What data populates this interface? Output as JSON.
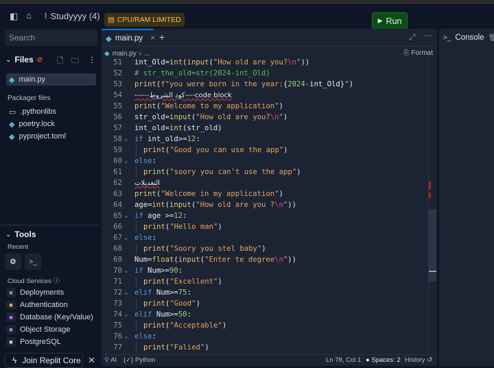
{
  "topbar": {
    "project": "Studyyyy (4)",
    "badge": "CPU/RAM LIMITED",
    "run": "Run"
  },
  "sidebar": {
    "search_placeholder": "Search",
    "files_title": "Files",
    "files": [
      {
        "name": "main.py",
        "icon": "python-icon"
      }
    ],
    "packager_title": "Packager files",
    "packager": [
      {
        "name": ".pythonlibs",
        "icon": "folder-icon"
      },
      {
        "name": "poetry.lock",
        "icon": "python-icon"
      },
      {
        "name": "pyproject.toml",
        "icon": "python-icon"
      }
    ],
    "tools_title": "Tools",
    "recent_title": "Recent",
    "cloud_title": "Cloud Services",
    "services": [
      {
        "name": "Deployments",
        "icon": "deployments-icon",
        "color": "#5dbb63"
      },
      {
        "name": "Authentication",
        "icon": "user-icon",
        "color": "#e8a55c"
      },
      {
        "name": "Database (Key/Value)",
        "icon": "database-icon",
        "color": "#a07ef0"
      },
      {
        "name": "Object Storage",
        "icon": "storage-icon",
        "color": "#4fb8d0"
      },
      {
        "name": "PostgreSQL",
        "icon": "postgres-icon",
        "color": "#c8ccd4"
      }
    ],
    "join": "Join Replit Core"
  },
  "editor": {
    "tab": "main.py",
    "breadcrumb": "main.py",
    "breadcrumb_more": "...",
    "format": "Format",
    "lines": [
      {
        "n": "51",
        "t": [
          [
            "p",
            "int_Old="
          ],
          [
            "f",
            "int"
          ],
          [
            "p",
            "("
          ],
          [
            "f",
            "input"
          ],
          [
            "p",
            "("
          ],
          [
            "s",
            "\"How old are you?"
          ],
          [
            "e",
            "\\n"
          ],
          [
            "s",
            "\""
          ],
          [
            "p",
            "))"
          ]
        ]
      },
      {
        "n": "52",
        "t": [
          [
            "c",
            "# str_the_old=str(2024-int_Old)"
          ]
        ]
      },
      {
        "n": "53",
        "t": [
          [
            "f",
            "print"
          ],
          [
            "p",
            "("
          ],
          [
            "s",
            "f\"you were born in the year:"
          ],
          [
            "p",
            "{"
          ],
          [
            "n",
            "2024"
          ],
          [
            "p",
            "-int_Old}"
          ],
          [
            "s",
            "\""
          ],
          [
            "p",
            ")"
          ]
        ]
      },
      {
        "n": "54",
        "t": [
          [
            "sq",
            "------كود الشروط----code block"
          ]
        ]
      },
      {
        "n": "55",
        "t": [
          [
            "f",
            "print"
          ],
          [
            "p",
            "("
          ],
          [
            "s",
            "\"Welcome to my application\""
          ],
          [
            "p",
            ")"
          ]
        ]
      },
      {
        "n": "56",
        "t": [
          [
            "p",
            "str_old="
          ],
          [
            "f",
            "input"
          ],
          [
            "p",
            "("
          ],
          [
            "s",
            "\"How old are you?"
          ],
          [
            "e",
            "\\n"
          ],
          [
            "s",
            "\""
          ],
          [
            "p",
            ")"
          ]
        ]
      },
      {
        "n": "57",
        "t": [
          [
            "p",
            "int_old="
          ],
          [
            "f",
            "int"
          ],
          [
            "p",
            "(str_old)"
          ]
        ]
      },
      {
        "n": "58",
        "fold": true,
        "t": [
          [
            "k",
            "if"
          ],
          [
            "p",
            " int_old>="
          ],
          [
            "n",
            "12"
          ],
          [
            "p",
            ":"
          ]
        ]
      },
      {
        "n": "59",
        "ind": true,
        "t": [
          [
            "f",
            "print"
          ],
          [
            "p",
            "("
          ],
          [
            "s",
            "\"Good you can use the app\""
          ],
          [
            "p",
            ")"
          ]
        ]
      },
      {
        "n": "60",
        "fold": true,
        "t": [
          [
            "k",
            "else"
          ],
          [
            "p",
            ":"
          ]
        ]
      },
      {
        "n": "61",
        "ind": true,
        "t": [
          [
            "f",
            "print"
          ],
          [
            "p",
            "("
          ],
          [
            "s",
            "\"soory you can't use the app\""
          ],
          [
            "p",
            ")"
          ]
        ]
      },
      {
        "n": "62",
        "t": [
          [
            "sq",
            "التعديلات"
          ]
        ]
      },
      {
        "n": "63",
        "t": [
          [
            "f",
            "print"
          ],
          [
            "p",
            "("
          ],
          [
            "s",
            "\"Welcome in my application\""
          ],
          [
            "p",
            ")"
          ]
        ]
      },
      {
        "n": "64",
        "t": [
          [
            "p",
            "age="
          ],
          [
            "f",
            "int"
          ],
          [
            "p",
            "("
          ],
          [
            "f",
            "input"
          ],
          [
            "p",
            "("
          ],
          [
            "s",
            "\"How old are you ?"
          ],
          [
            "e",
            "\\n"
          ],
          [
            "s",
            "\""
          ],
          [
            "p",
            "))"
          ]
        ]
      },
      {
        "n": "65",
        "fold": true,
        "t": [
          [
            "k",
            "if"
          ],
          [
            "p",
            " age >="
          ],
          [
            "n",
            "12"
          ],
          [
            "p",
            ":"
          ]
        ]
      },
      {
        "n": "66",
        "ind": true,
        "t": [
          [
            "f",
            "print"
          ],
          [
            "p",
            "("
          ],
          [
            "s",
            "\"Hello man\""
          ],
          [
            "p",
            ")"
          ]
        ]
      },
      {
        "n": "67",
        "fold": true,
        "t": [
          [
            "k",
            "else"
          ],
          [
            "p",
            ":"
          ]
        ]
      },
      {
        "n": "68",
        "ind": true,
        "t": [
          [
            "f",
            "print"
          ],
          [
            "p",
            "("
          ],
          [
            "s",
            "\"Soory you stel baby\""
          ],
          [
            "p",
            ")"
          ]
        ]
      },
      {
        "n": "69",
        "t": [
          [
            "p",
            "Num="
          ],
          [
            "f",
            "float"
          ],
          [
            "p",
            "("
          ],
          [
            "f",
            "input"
          ],
          [
            "p",
            "("
          ],
          [
            "s",
            "\"Enter te degree"
          ],
          [
            "e",
            "\\n"
          ],
          [
            "s",
            "\""
          ],
          [
            "p",
            "))"
          ]
        ]
      },
      {
        "n": "70",
        "fold": true,
        "t": [
          [
            "k",
            "if"
          ],
          [
            "p",
            " Num>="
          ],
          [
            "n",
            "90"
          ],
          [
            "p",
            ":"
          ]
        ]
      },
      {
        "n": "71",
        "ind": true,
        "t": [
          [
            "f",
            "print"
          ],
          [
            "p",
            "("
          ],
          [
            "s",
            "\"Excellent\""
          ],
          [
            "p",
            ")"
          ]
        ]
      },
      {
        "n": "72",
        "fold": true,
        "t": [
          [
            "k",
            "elif"
          ],
          [
            "p",
            " Num>="
          ],
          [
            "n",
            "75"
          ],
          [
            "p",
            ":"
          ]
        ]
      },
      {
        "n": "73",
        "ind": true,
        "t": [
          [
            "f",
            "print"
          ],
          [
            "p",
            "("
          ],
          [
            "s",
            "\"Good\""
          ],
          [
            "p",
            ")"
          ]
        ]
      },
      {
        "n": "74",
        "fold": true,
        "t": [
          [
            "k",
            "elif"
          ],
          [
            "p",
            " Num>="
          ],
          [
            "n",
            "50"
          ],
          [
            "p",
            ":"
          ]
        ]
      },
      {
        "n": "75",
        "ind": true,
        "t": [
          [
            "f",
            "print"
          ],
          [
            "p",
            "("
          ],
          [
            "s",
            "\"Acceptable\""
          ],
          [
            "p",
            ")"
          ]
        ]
      },
      {
        "n": "76",
        "fold": true,
        "t": [
          [
            "k",
            "else"
          ],
          [
            "p",
            ":"
          ]
        ]
      },
      {
        "n": "77",
        "ind": true,
        "t": [
          [
            "f",
            "print"
          ],
          [
            "p",
            "("
          ],
          [
            "s",
            "\"Falied\""
          ],
          [
            "p",
            ")"
          ]
        ]
      }
    ],
    "status": {
      "ai": "AI",
      "lang": "Python",
      "position": "Ln 78, Col 1",
      "spaces": "Spaces: 2",
      "history": "History"
    }
  },
  "console": {
    "title": "Console"
  }
}
